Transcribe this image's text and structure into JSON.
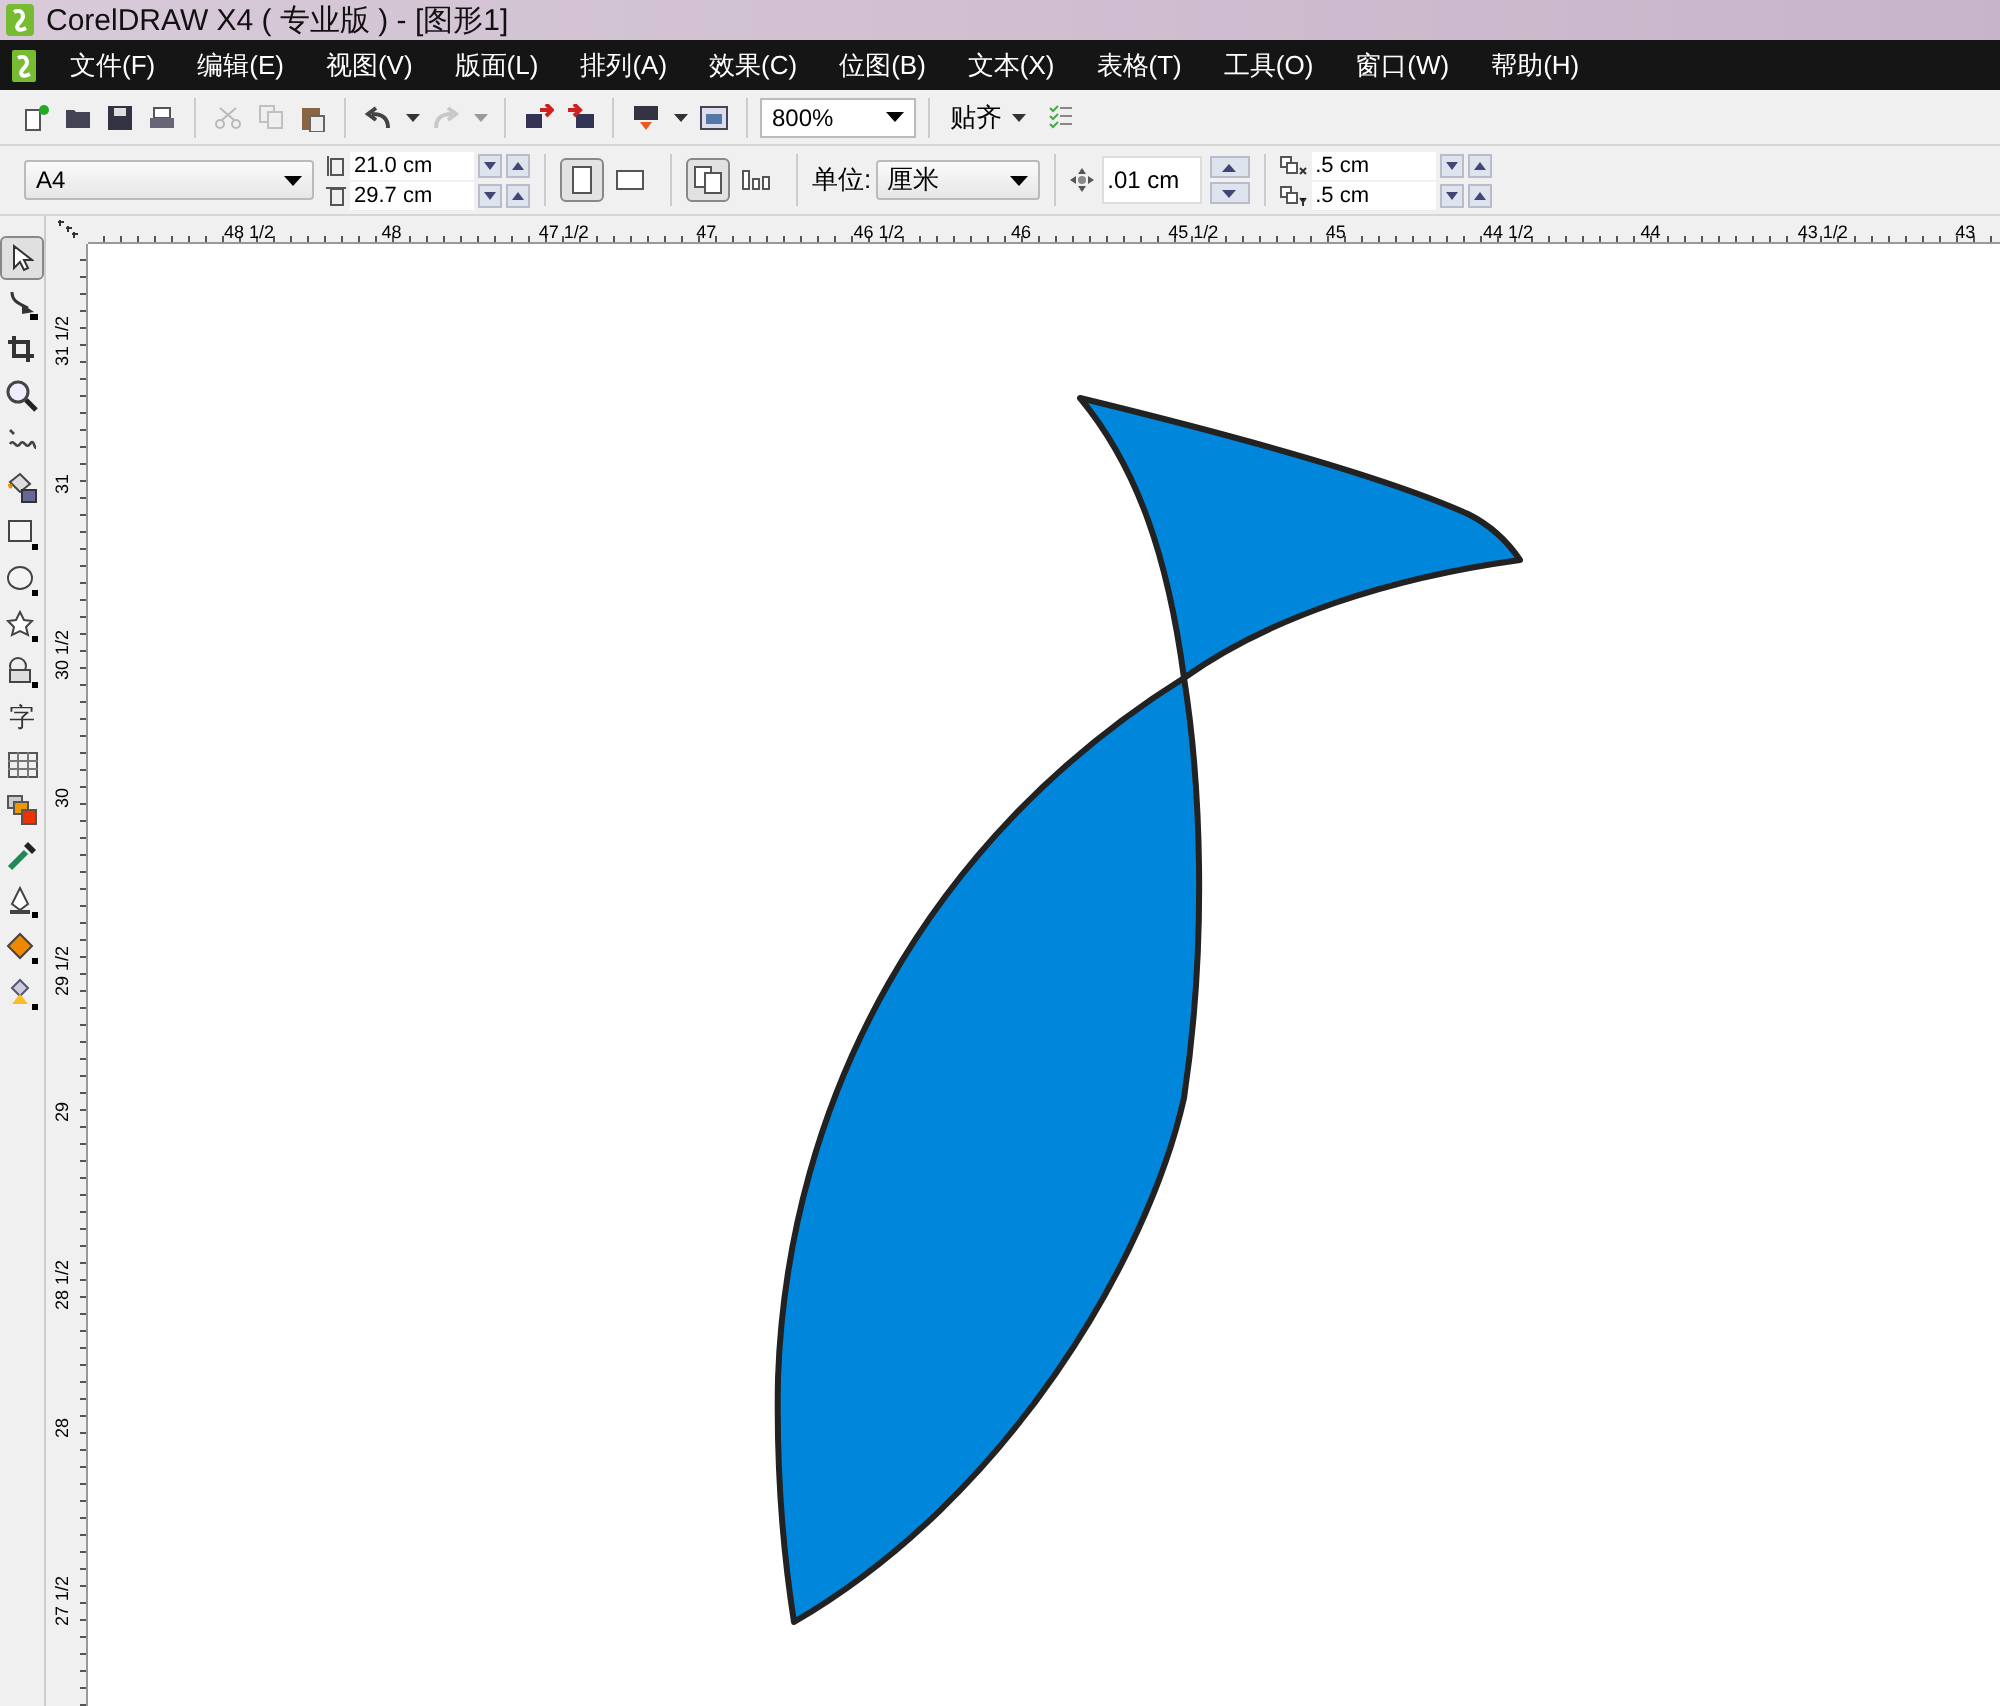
{
  "window": {
    "title": "CorelDRAW X4 ( 专业版 ) - [图形1]"
  },
  "menu": [
    "文件(F)",
    "编辑(E)",
    "视图(V)",
    "版面(L)",
    "排列(A)",
    "效果(C)",
    "位图(B)",
    "文本(X)",
    "表格(T)",
    "工具(O)",
    "窗口(W)",
    "帮助(H)"
  ],
  "standard_toolbar": {
    "buttons": [
      {
        "kind": "new",
        "disabled": false
      },
      {
        "kind": "open",
        "disabled": false
      },
      {
        "kind": "save",
        "disabled": false
      },
      {
        "kind": "print",
        "disabled": false
      },
      {
        "kind": "sep"
      },
      {
        "kind": "cut",
        "disabled": true
      },
      {
        "kind": "copy",
        "disabled": true
      },
      {
        "kind": "paste",
        "disabled": false
      },
      {
        "kind": "sep"
      },
      {
        "kind": "undo",
        "disabled": false
      },
      {
        "kind": "drop",
        "disabled": false
      },
      {
        "kind": "redo",
        "disabled": true
      },
      {
        "kind": "drop",
        "disabled": true
      },
      {
        "kind": "sep"
      },
      {
        "kind": "import",
        "disabled": false
      },
      {
        "kind": "export",
        "disabled": false
      },
      {
        "kind": "sep"
      },
      {
        "kind": "publish",
        "disabled": false
      },
      {
        "kind": "drop",
        "disabled": false
      },
      {
        "kind": "window",
        "disabled": false
      }
    ],
    "zoom": "800%",
    "snap": "贴齐"
  },
  "property_bar": {
    "page_size": "A4",
    "width": "21.0 cm",
    "height": "29.7 cm",
    "orientation": [
      {
        "kind": "portrait",
        "selected": true
      },
      {
        "kind": "landscape",
        "selected": false
      }
    ],
    "pages": [
      {
        "kind": "all",
        "selected": true
      },
      {
        "kind": "current",
        "selected": false
      }
    ],
    "unit_label": "单位:",
    "unit": "厘米",
    "nudge": ".01 cm",
    "duplicate_x": ".5 cm",
    "duplicate_y": ".5 cm"
  },
  "toolbox": [
    {
      "kind": "pick",
      "selected": true
    },
    {
      "kind": "shape",
      "selected": false
    },
    {
      "kind": "crop",
      "selected": false
    },
    {
      "kind": "zoom",
      "selected": false
    },
    {
      "kind": "freehand",
      "selected": false
    },
    {
      "kind": "smartfill",
      "selected": false
    },
    {
      "kind": "rectangle",
      "selected": false
    },
    {
      "kind": "ellipse",
      "selected": false
    },
    {
      "kind": "star",
      "selected": false
    },
    {
      "kind": "shapes",
      "selected": false
    },
    {
      "kind": "text",
      "glyph": "字",
      "selected": false
    },
    {
      "kind": "table",
      "selected": false
    },
    {
      "kind": "blend",
      "selected": false
    },
    {
      "kind": "eyedropper",
      "selected": false
    },
    {
      "kind": "outline",
      "selected": false
    },
    {
      "kind": "fill",
      "selected": false
    },
    {
      "kind": "interactivefill",
      "selected": false
    }
  ],
  "horizontal_ruler": [
    "48 1/2",
    "48",
    "47 1/2",
    "47",
    "46 1/2",
    "46",
    "45 1/2",
    "45",
    "44 1/2",
    "44",
    "43 1/2",
    "43"
  ],
  "vertical_ruler": [
    "31 1/2",
    "31",
    "30 1/2",
    "30",
    "29 1/2",
    "29",
    "28 1/2",
    "28",
    "27 1/2"
  ]
}
